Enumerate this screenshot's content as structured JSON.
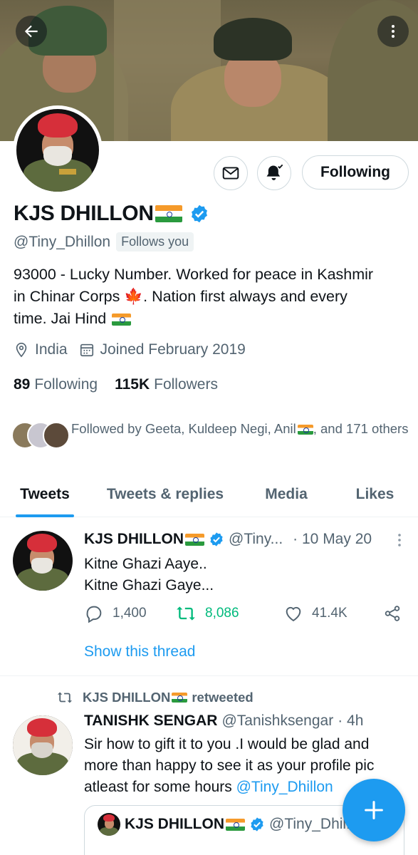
{
  "profile": {
    "name": "KJS DHILLON",
    "handle": "@Tiny_Dhillon",
    "follows_you": "Follows you",
    "bio_line1": "93000 - Lucky Number. Worked for peace in Kashmir",
    "bio_line2_a": "in Chinar Corps ",
    "bio_line2_b": ". Nation first always and every",
    "bio_line3": "time. Jai Hind ",
    "location": "India",
    "joined": "Joined February 2019",
    "following_count": "89",
    "following_label": "Following",
    "followers_count": "115K",
    "followers_label": "Followers",
    "followed_by_a": "Followed by Geeta, Kuldeep Negi, Anil",
    "followed_by_b": ", and 171 others"
  },
  "actions": {
    "following_button": "Following"
  },
  "tabs": [
    {
      "label": "Tweets",
      "active": true
    },
    {
      "label": "Tweets & replies",
      "active": false
    },
    {
      "label": "Media",
      "active": false
    },
    {
      "label": "Likes",
      "active": false
    }
  ],
  "tweets": [
    {
      "author": "KJS DHILLON",
      "handle": "@Tiny...",
      "time": "· 10 May 20",
      "line1": "Kitne Ghazi Aaye..",
      "line2": "Kitne Ghazi Gaye...",
      "replies": "1,400",
      "retweets": "8,086",
      "likes": "41.4K",
      "show_thread": "Show this thread"
    },
    {
      "retweeted_by": "KJS DHILLON",
      "retweeted_label": "retweeted",
      "author": "TANISHK SENGAR",
      "handle": "@Tanishksengar",
      "time": "· 4h",
      "line1": "Sir how to gift it to you .I would be glad and",
      "line2": "more than happy to see it as your profile pic",
      "line3_a": "atleast for some hours ",
      "line3_mention": "@Tiny_Dhillon",
      "quote_author": "KJS DHILLON",
      "quote_handle": "@Tiny_Dhil..."
    }
  ],
  "colors": {
    "accent": "#1d9bf0",
    "retweet_green": "#00ba7c",
    "secondary_text": "#536471",
    "border": "#cfd9de"
  },
  "icons": [
    "back-arrow-icon",
    "more-vertical-icon",
    "mail-icon",
    "bell-check-icon",
    "verified-badge-icon",
    "location-icon",
    "calendar-icon",
    "reply-icon",
    "retweet-icon",
    "like-icon",
    "share-icon",
    "plus-icon"
  ]
}
